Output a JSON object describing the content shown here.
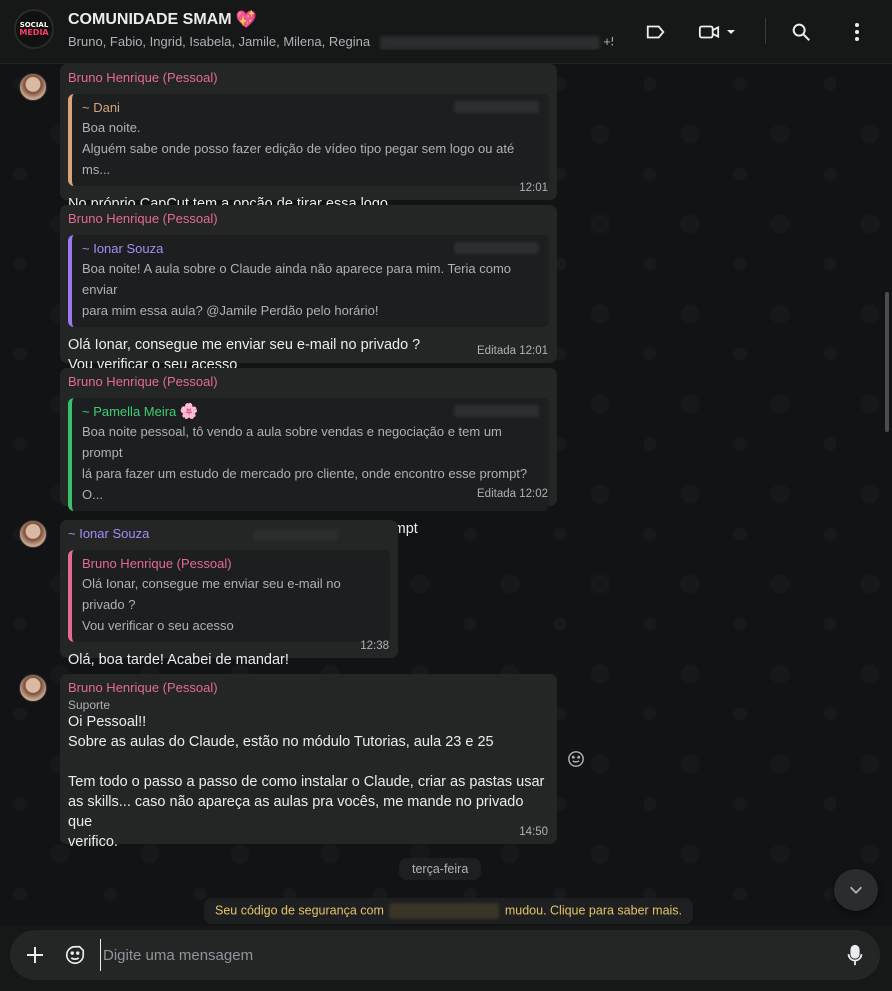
{
  "header": {
    "avatar_text_1": "SOCIAL",
    "avatar_text_2": "MEDIA",
    "title": "COMUNIDADE SMAM",
    "title_emoji": "💖",
    "members": "Bruno, Fabio, Ingrid, Isabela, Jamile, Milena, Regina",
    "members_tail": "+5...",
    "icons": [
      "label-icon",
      "video-call-icon",
      "chevron-down-icon",
      "search-icon",
      "more-options-icon"
    ]
  },
  "messages": [
    {
      "sender": "Bruno Henrique (Pessoal)",
      "quote_author": "~ Dani",
      "quote_lines": [
        "Boa noite.",
        "Alguém sabe onde posso fazer edição de vídeo tipo pegar sem logo ou até ms..."
      ],
      "text_lines": [
        "No próprio CapCut tem a opção de tirar essa logo"
      ],
      "time": "12:01"
    },
    {
      "sender": "Bruno Henrique (Pessoal)",
      "quote_author": "~ Ionar Souza",
      "quote_lines": [
        "Boa noite! A aula sobre o Claude ainda não aparece para mim. Teria como enviar",
        "para mim essa aula? @Jamile  Perdão pelo horário!"
      ],
      "text_lines": [
        "Olá Ionar, consegue me enviar seu e-mail no privado ?",
        "Vou verificar o seu acesso"
      ],
      "time": "Editada 12:01"
    },
    {
      "sender": "Bruno Henrique (Pessoal)",
      "quote_author": "~ Pamella Meira",
      "quote_author_emoji": "🌸",
      "quote_lines": [
        "Boa noite pessoal, tô vendo a aula sobre vendas e negociação e tem um prompt",
        "lá para fazer um estudo de mercado pro cliente, onde encontro esse prompt? O..."
      ],
      "text_lines": [
        "Oi Pamella, normalmente fica abaixo da aula o prompt"
      ],
      "time": "Editada 12:02"
    },
    {
      "sender": "~ Ionar Souza",
      "quote_author": "Bruno Henrique (Pessoal)",
      "quote_lines": [
        "Olá Ionar, consegue me enviar seu e-mail no privado ?",
        "Vou verificar o seu acesso"
      ],
      "text_lines": [
        "Olá, boa tarde! Acabei de mandar!"
      ],
      "time": "12:38"
    },
    {
      "sender": "Bruno Henrique (Pessoal)",
      "label": "Suporte",
      "text_lines": [
        "Oi Pessoal!!",
        "Sobre as aulas do Claude, estão no módulo Tutorias, aula 23 e 25",
        "",
        "Tem todo o passo a passo de como instalar o Claude, criar as pastas usar",
        "as skills... caso não apareça as aulas pra vocês, me mande no privado que",
        "verifico."
      ],
      "time": "14:50"
    }
  ],
  "day_divider": "terça-feira",
  "system_message": {
    "prefix": "Seu código de segurança com",
    "suffix": "mudou. Clique para saber mais."
  },
  "composer": {
    "placeholder": "Digite uma mensagem"
  }
}
